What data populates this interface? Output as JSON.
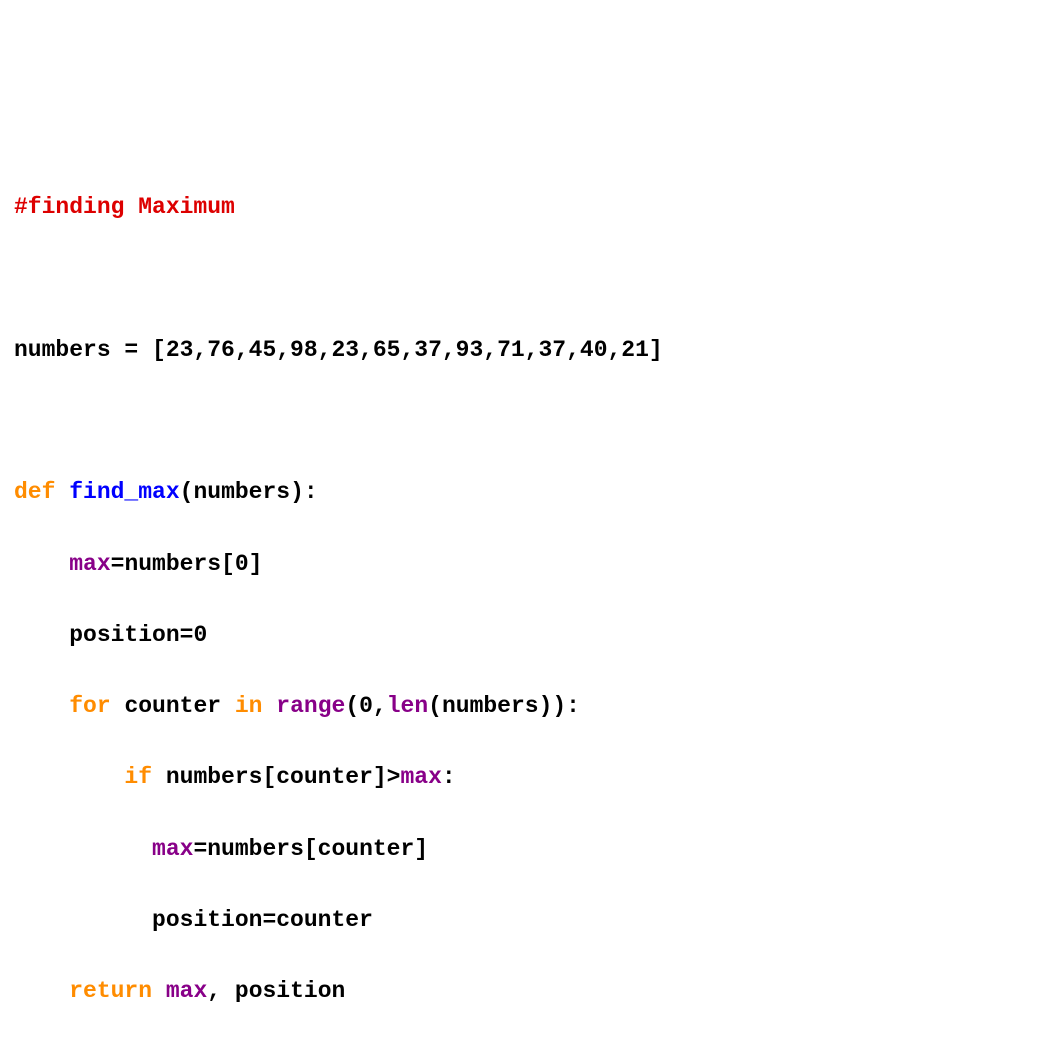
{
  "code": {
    "comment": "#finding Maximum",
    "assign_numbers": "numbers = [23,76,45,98,23,65,37,93,71,37,40,21]",
    "kw_def": "def",
    "func_name": " find_max",
    "def_rest": "(numbers):",
    "indent1": "    ",
    "indent2": "        ",
    "indent25": "          ",
    "builtin_max": "max",
    "max_init_rest": "=numbers[0]",
    "pos_init": "position=0",
    "kw_for": "for",
    "for_counter": " counter ",
    "kw_in": "in",
    "space": " ",
    "builtin_range": "range",
    "for_after_range": "(0,",
    "builtin_len": "len",
    "for_tail": "(numbers)):",
    "kw_if": "if",
    "if_middle": " numbers[counter]>",
    "colon": ":",
    "max_assign_rest": "=numbers[counter]",
    "pos_assign": "position=counter",
    "kw_return": "return",
    "return_rest": ", position"
  }
}
